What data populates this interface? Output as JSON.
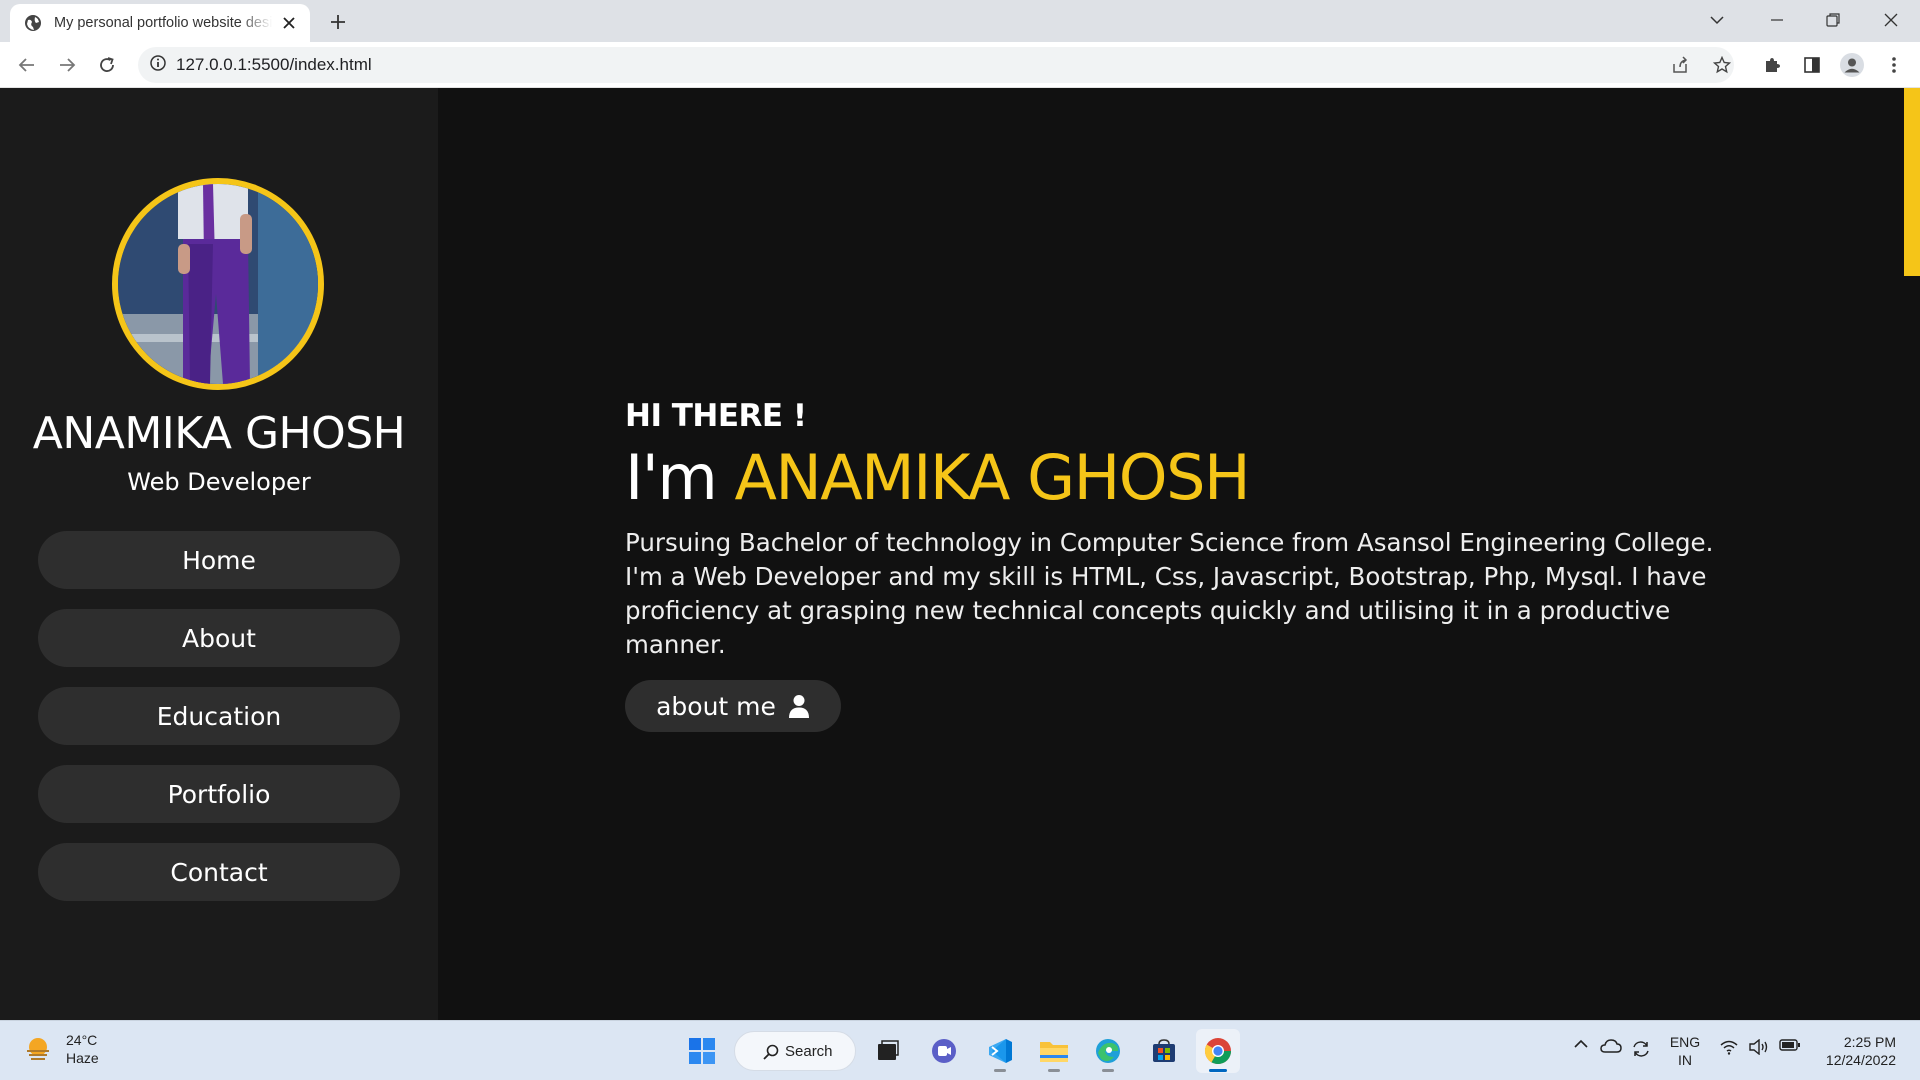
{
  "browser": {
    "tab_title": "My personal portfolio website design",
    "url": "127.0.0.1:5500/index.html"
  },
  "sidebar": {
    "name": "ANAMIKA GHOSH",
    "role": "Web Developer",
    "nav": [
      {
        "label": "Home"
      },
      {
        "label": "About"
      },
      {
        "label": "Education"
      },
      {
        "label": "Portfolio"
      },
      {
        "label": "Contact"
      }
    ]
  },
  "hero": {
    "greeting": "HI THERE !",
    "heading_prefix": "I'm",
    "heading_name": "ANAMIKA GHOSH",
    "description": "Pursuing Bachelor of technology in Computer Science from Asansol Engineering College. I'm a Web Developer and my skill is HTML, Css, Javascript, Bootstrap, Php, Mysql. I have proficiency at grasping new technical concepts quickly and utilising it in a productive manner.",
    "button_label": "about me",
    "button_icon": "user-icon"
  },
  "taskbar": {
    "weather_temp": "24°C",
    "weather_desc": "Haze",
    "search_label": "Search",
    "lang_top": "ENG",
    "lang_bottom": "IN",
    "time": "2:25 PM",
    "date": "12/24/2022"
  },
  "colors": {
    "accent": "#f5c518",
    "page_bg": "#111111",
    "sidebar_bg": "#1b1b1b",
    "button_bg": "#2e2e2e"
  }
}
